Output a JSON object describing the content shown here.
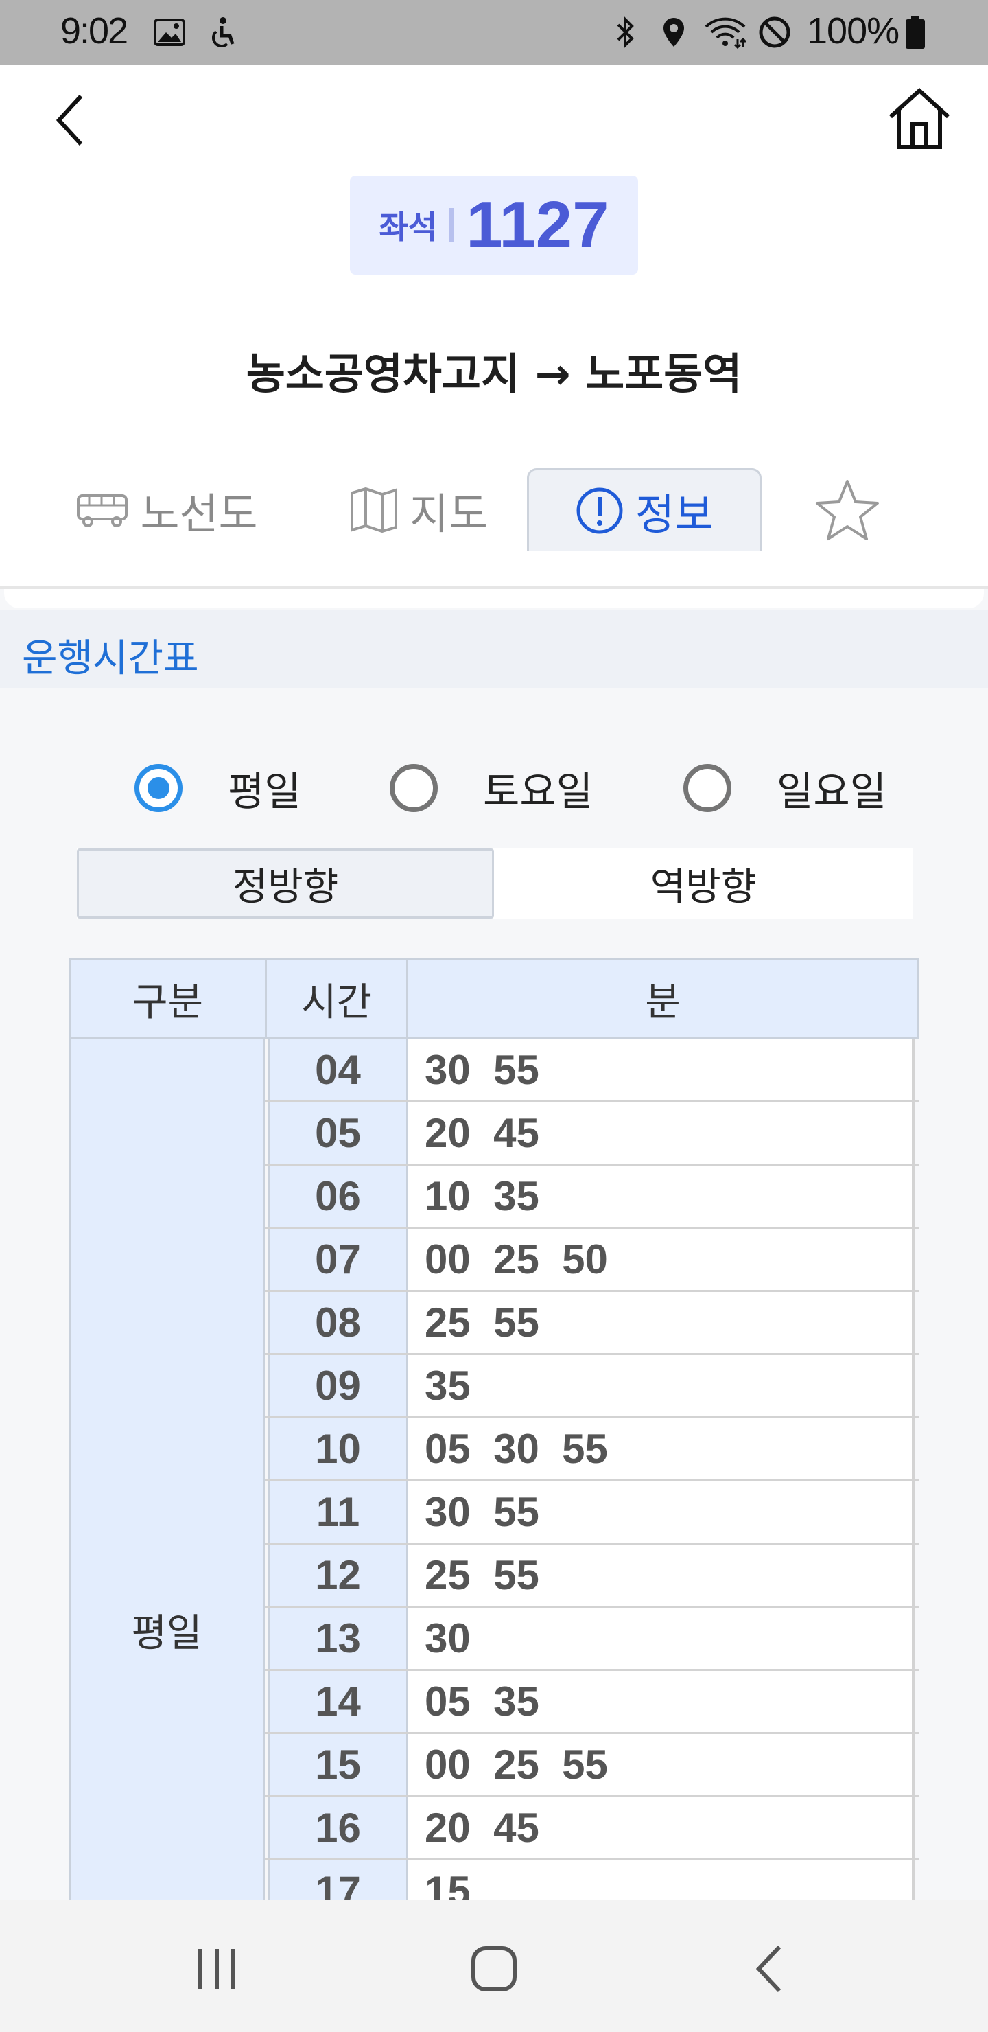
{
  "status_bar": {
    "time": "9:02",
    "battery": "100%",
    "icons": [
      "image-icon",
      "accessibility-icon",
      "bluetooth-icon",
      "location-icon",
      "wifi-icon",
      "do-not-disturb-icon",
      "battery-icon"
    ]
  },
  "header": {
    "route_type": "좌석",
    "route_number": "1127",
    "route_title": "농소공영차고지 → 노포동역",
    "accent_color": "#4b5bd6"
  },
  "tabs": [
    {
      "label": "노선도",
      "icon": "bus-icon",
      "active": false
    },
    {
      "label": "지도",
      "icon": "map-icon",
      "active": false
    },
    {
      "label": "정보",
      "icon": "info-icon",
      "active": true
    },
    {
      "label": "",
      "icon": "star-icon",
      "active": false
    }
  ],
  "timetable": {
    "section_title": "운행시간표",
    "day_options": [
      {
        "label": "평일",
        "selected": true
      },
      {
        "label": "토요일",
        "selected": false
      },
      {
        "label": "일요일",
        "selected": false
      }
    ],
    "directions": {
      "forward": "정방향",
      "reverse": "역방향"
    },
    "columns": {
      "category": "구분",
      "hour": "시간",
      "minute": "분"
    },
    "category_label": "평일",
    "rows": [
      {
        "hour": "04",
        "minutes": "30  55"
      },
      {
        "hour": "05",
        "minutes": "20  45"
      },
      {
        "hour": "06",
        "minutes": "10  35"
      },
      {
        "hour": "07",
        "minutes": "00  25  50"
      },
      {
        "hour": "08",
        "minutes": "25  55"
      },
      {
        "hour": "09",
        "minutes": "35"
      },
      {
        "hour": "10",
        "minutes": "05  30  55"
      },
      {
        "hour": "11",
        "minutes": "30  55"
      },
      {
        "hour": "12",
        "minutes": "25  55"
      },
      {
        "hour": "13",
        "minutes": "30"
      },
      {
        "hour": "14",
        "minutes": "05  35"
      },
      {
        "hour": "15",
        "minutes": "00  25  55"
      },
      {
        "hour": "16",
        "minutes": "20  45"
      },
      {
        "hour": "17",
        "minutes": "15"
      }
    ]
  },
  "nav_bar": {
    "buttons": [
      "recent-apps-icon",
      "home-icon",
      "back-icon"
    ]
  }
}
